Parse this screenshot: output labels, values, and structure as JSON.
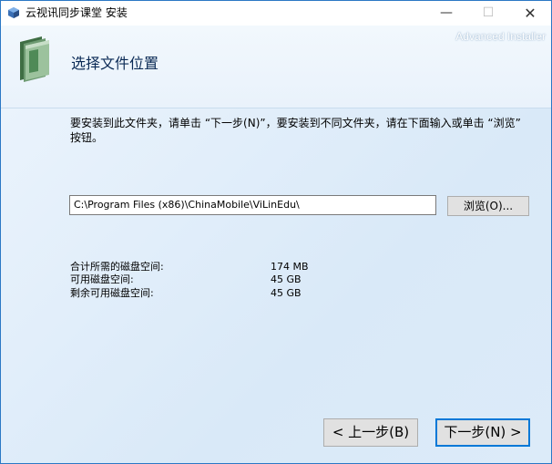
{
  "window": {
    "title": "云视讯同步课堂 安装",
    "minimize_symbol": "—",
    "maximize_symbol": "☐",
    "close_symbol": "✕"
  },
  "header": {
    "brand": "Advanced Installer",
    "page_title": "选择文件位置",
    "icon": "folder-icon"
  },
  "content": {
    "instructions": "要安装到此文件夹，请单击 “下一步(N)”，要安装到不同文件夹，请在下面输入或单击 “浏览” 按钮。",
    "install_path": "C:\\Program Files (x86)\\ChinaMobile\\ViLinEdu\\",
    "browse_label": "浏览(O)...",
    "space": [
      {
        "label": "合计所需的磁盘空间:",
        "value": "174 MB"
      },
      {
        "label": "可用磁盘空间:",
        "value": "45 GB"
      },
      {
        "label": "剩余可用磁盘空间:",
        "value": "45 GB"
      }
    ]
  },
  "footer": {
    "back_label": "< 上一步(B)",
    "next_label": "下一步(N) >"
  },
  "colors": {
    "accent": "#0078d7",
    "title_text": "#0a2a55",
    "background": "#e6f1fb"
  }
}
